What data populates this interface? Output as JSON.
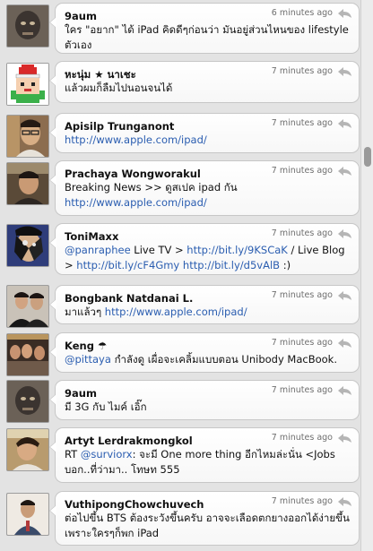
{
  "tweets": [
    {
      "name": "9aum",
      "time": "6 minutes ago",
      "parts": [
        {
          "t": "ใคร \"อยาก\" ได้ iPad คิดดีๆก่อนว่า มันอยู่ส่วนไหนของ lifestyle ตัวเอง"
        }
      ]
    },
    {
      "name": "หะนุ่ม ★ นาเชะ",
      "time": "7 minutes ago",
      "parts": [
        {
          "t": "แล้วผมก็ลืมไปนอนจนได้"
        }
      ]
    },
    {
      "name": "Apisilp Trunganont",
      "time": "7 minutes ago",
      "parts": [
        {
          "l": "http://www.apple.com/ipad/"
        }
      ]
    },
    {
      "name": "Prachaya Wongworakul",
      "time": "7 minutes ago",
      "parts": [
        {
          "t": "Breaking News >>  ดูสเปค ipad กัน "
        },
        {
          "l": "http://www.apple.com/ipad/"
        }
      ]
    },
    {
      "name": "ToniMaxx",
      "time": "7 minutes ago",
      "parts": [
        {
          "l": "@panraphee"
        },
        {
          "t": " Live TV > "
        },
        {
          "l": "http://bit.ly/9KSCaK"
        },
        {
          "t": " / Live Blog > "
        },
        {
          "l": "http://bit.ly/cF4Gmy"
        },
        {
          "t": "  "
        },
        {
          "l": "http://bit.ly/d5vAlB"
        },
        {
          "t": "  :)"
        }
      ]
    },
    {
      "name": "Bongbank Natdanai L.",
      "time": "7 minutes ago",
      "parts": [
        {
          "t": "มาแล้วๆ "
        },
        {
          "l": "http://www.apple.com/ipad/"
        }
      ]
    },
    {
      "name": "Keng ☂",
      "time": "7 minutes ago",
      "parts": [
        {
          "l": "@pittaya"
        },
        {
          "t": " กำลังดู เผื่อจะเคลิ้มแบบตอน Unibody MacBook."
        }
      ]
    },
    {
      "name": "9aum",
      "time": "7 minutes ago",
      "parts": [
        {
          "t": "มี 3G กับ ไมค์ เอิ๊ก"
        }
      ]
    },
    {
      "name": "Artyt Lerdrakmongkol",
      "time": "7 minutes ago",
      "parts": [
        {
          "t": "RT "
        },
        {
          "l": "@surviorx"
        },
        {
          "t": ": จะมี One more thing อีกไหมล่ะนั่น <Jobs บอก..ที่ว่ามา.. โทษท 555"
        }
      ]
    },
    {
      "name": "VuthipongChowchuvech",
      "time": "7 minutes ago",
      "parts": [
        {
          "t": "ต่อไปขึ้น BTS ต้องระวังขึ้นครับ อาจจะเลือดตกยางออกได้ง่ายขึ้น เพราะใครๆก็พก iPad"
        }
      ]
    }
  ],
  "colors": {
    "link": "#2a5db0",
    "background": "#e3e3e3",
    "bubble": "#ffffff",
    "muted": "#6f6f6f"
  },
  "icons": {
    "reply": "reply-arrow-icon",
    "avatar": "avatar"
  }
}
